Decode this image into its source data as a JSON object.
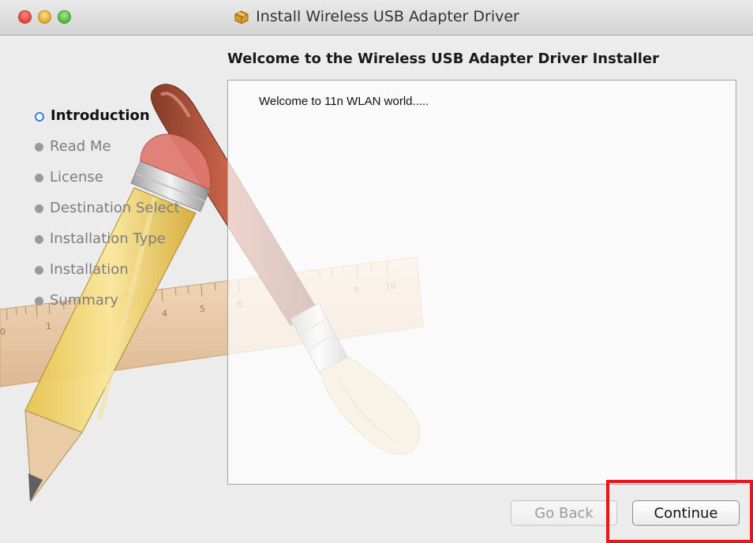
{
  "window": {
    "title": "Install Wireless USB Adapter Driver",
    "title_icon": "package-icon"
  },
  "main": {
    "heading": "Welcome to the Wireless USB Adapter Driver Installer",
    "body_text": "Welcome to 11n WLAN world....."
  },
  "sidebar": {
    "items": [
      {
        "label": "Introduction",
        "active": true
      },
      {
        "label": "Read Me",
        "active": false
      },
      {
        "label": "License",
        "active": false
      },
      {
        "label": "Destination Select",
        "active": false
      },
      {
        "label": "Installation Type",
        "active": false
      },
      {
        "label": "Installation",
        "active": false
      },
      {
        "label": "Summary",
        "active": false
      }
    ]
  },
  "buttons": {
    "go_back": "Go Back",
    "continue": "Continue"
  },
  "colors": {
    "active_step": "#3a7be0",
    "highlight_box": "#e8161b"
  },
  "ruler_ticks": [
    "0",
    "1",
    "4",
    "5",
    "6",
    "9",
    "10"
  ]
}
